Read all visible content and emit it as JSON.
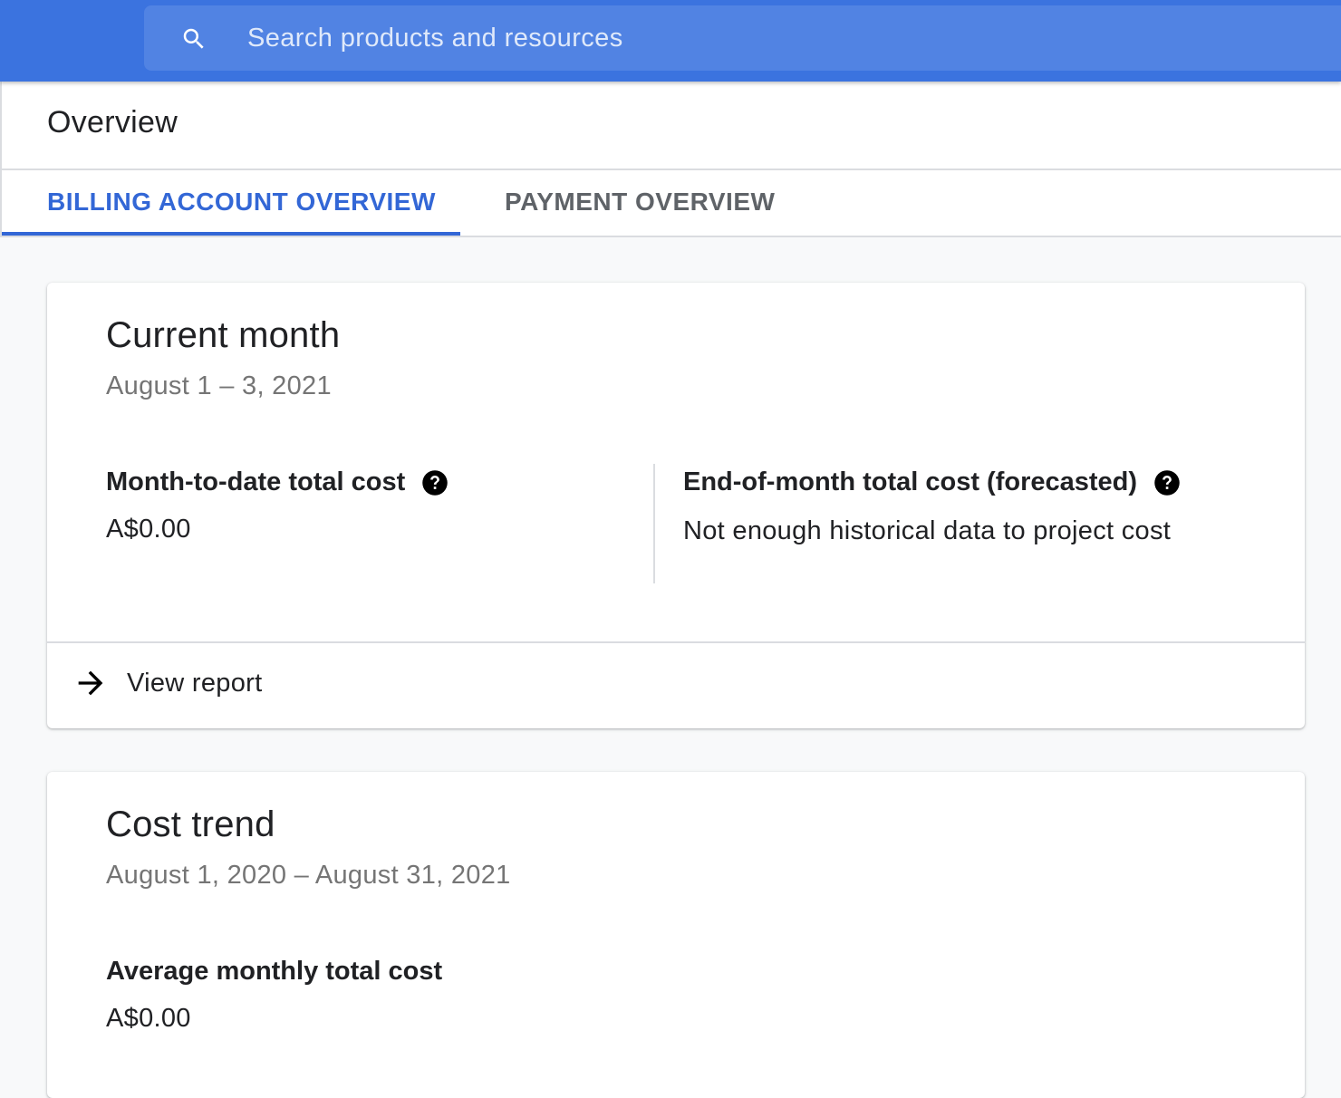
{
  "search": {
    "placeholder": "Search products and resources",
    "icon": "search-icon"
  },
  "header": {
    "title": "Overview"
  },
  "tabs": [
    {
      "label": "BILLING ACCOUNT OVERVIEW",
      "active": true
    },
    {
      "label": "PAYMENT OVERVIEW",
      "active": false
    }
  ],
  "current_month": {
    "title": "Current month",
    "date_range": "August 1 – 3, 2021",
    "month_to_date": {
      "label": "Month-to-date total cost",
      "value": "A$0.00",
      "icon": "help-icon"
    },
    "forecast": {
      "label": "End-of-month total cost (forecasted)",
      "value": "Not enough historical data to project cost",
      "icon": "help-icon"
    },
    "view_report": {
      "label": "View report",
      "icon": "arrow-right-icon"
    }
  },
  "cost_trend": {
    "title": "Cost trend",
    "date_range": "August 1, 2020 – August 31, 2021",
    "average": {
      "label": "Average monthly total cost",
      "value": "A$0.00"
    }
  },
  "colors": {
    "topbar": "#3b73df",
    "search_bg": "#5183e3",
    "accent": "#3367d6"
  }
}
